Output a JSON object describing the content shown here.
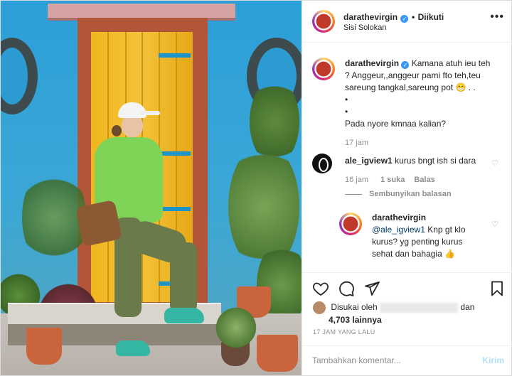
{
  "header": {
    "username": "darathevirgin",
    "separator": "•",
    "follow_status": "Diikuti",
    "location": "Sisi Solokan",
    "more_icon": "more-horizontal-icon"
  },
  "caption": {
    "username": "darathevirgin",
    "text_lines": [
      "Kamana atuh ieu teh",
      "? Anggeur,,anggeur pami fto teh,teu",
      "sareung tangkal,sareung pot 😁 . .",
      "•",
      "•",
      "Pada nyore kmnaa kalian?"
    ],
    "time": "17 jam"
  },
  "comment1": {
    "username": "ale_igview1",
    "text": "kurus bngt ish si dara",
    "time": "16 jam",
    "likes": "1 suka",
    "reply": "Balas",
    "hide_replies": "Sembunyikan balasan"
  },
  "reply1": {
    "username": "darathevirgin",
    "mention": "@ale_igview1",
    "text_lines": [
      " Knp gt klo",
      "kurus? yg penting kurus",
      "sehat dan bahagia 👍"
    ]
  },
  "actions": {
    "like_icon": "heart-icon",
    "comment_icon": "comment-icon",
    "share_icon": "share-icon",
    "save_icon": "bookmark-icon"
  },
  "likes": {
    "prefix": "Disukai oleh",
    "suffix": "dan",
    "count": "4,703 lainnya"
  },
  "timestamp": "17 JAM YANG LALU",
  "add_comment": {
    "placeholder": "Tambahkan komentar...",
    "post_label": "Kirim"
  },
  "colors": {
    "link": "#00376b",
    "verified": "#3897f0",
    "post_disabled": "#b2dffc"
  }
}
